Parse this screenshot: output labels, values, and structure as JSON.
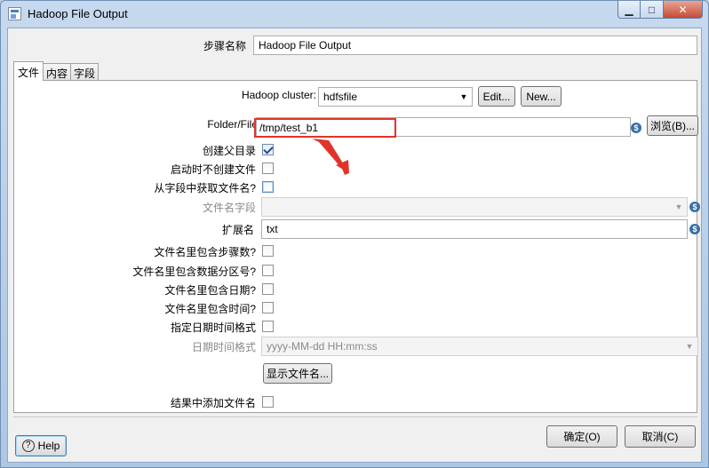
{
  "window": {
    "title": "Hadoop File Output"
  },
  "step_name": {
    "label": "步骤名称",
    "value": "Hadoop File Output"
  },
  "tabs": [
    {
      "label": "文件"
    },
    {
      "label": "内容"
    },
    {
      "label": "字段"
    }
  ],
  "file_tab": {
    "hadoop_cluster": {
      "label": "Hadoop cluster:",
      "value": "hdfsfile",
      "edit_label": "Edit...",
      "new_label": "New..."
    },
    "folder_file": {
      "label": "Folder/File",
      "value": "/tmp/test_b1",
      "browse_label": "浏览(B)..."
    },
    "create_parent": {
      "label": "创建父目录",
      "checked": true
    },
    "no_create_on_start": {
      "label": "启动时不创建文件",
      "checked": false
    },
    "filename_from_field": {
      "label": "从字段中获取文件名?",
      "checked": false
    },
    "filename_field": {
      "label": "文件名字段",
      "value": ""
    },
    "extension": {
      "label": "扩展名",
      "value": "txt"
    },
    "include_stepnr": {
      "label": "文件名里包含步骤数?",
      "checked": false
    },
    "include_partnr": {
      "label": "文件名里包含数据分区号?",
      "checked": false
    },
    "include_date": {
      "label": "文件名里包含日期?",
      "checked": false
    },
    "include_time": {
      "label": "文件名里包含时间?",
      "checked": false
    },
    "specify_format": {
      "label": "指定日期时间格式",
      "checked": false
    },
    "date_time_format": {
      "label": "日期时间格式",
      "value": "yyyy-MM-dd HH:mm:ss"
    },
    "show_filenames_label": "显示文件名...",
    "add_to_result": {
      "label": "结果中添加文件名",
      "checked": false
    }
  },
  "footer": {
    "help_label": "Help",
    "ok_label": "确定(O)",
    "cancel_label": "取消(C)"
  },
  "colors": {
    "annotation_red": "#e0332a",
    "titlebar_blue": "#b9cfe6"
  }
}
